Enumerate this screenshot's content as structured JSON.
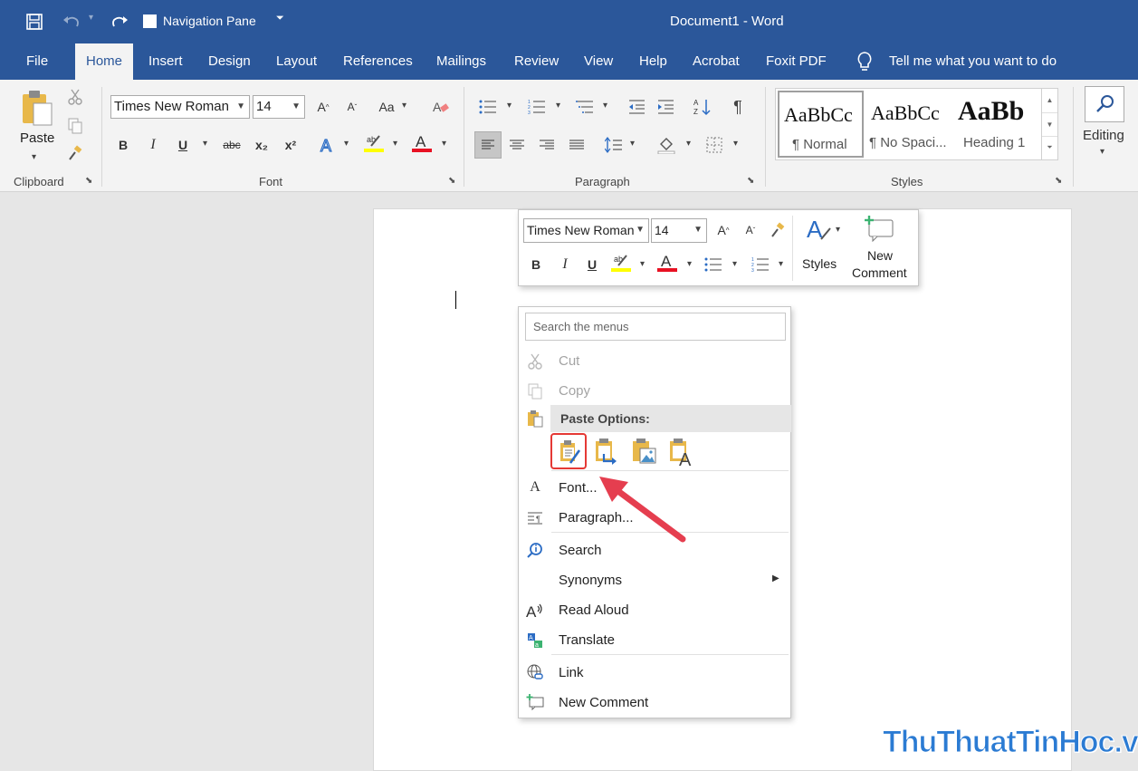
{
  "titlebar": {
    "qat_checkbox_label": "Navigation Pane",
    "doc_title": "Document1 - Word"
  },
  "tabs": [
    "File",
    "Home",
    "Insert",
    "Design",
    "Layout",
    "References",
    "Mailings",
    "Review",
    "View",
    "Help",
    "Acrobat",
    "Foxit PDF"
  ],
  "tell_me": "Tell me what you want to do",
  "ribbon": {
    "clipboard": {
      "paste_label": "Paste",
      "group_label": "Clipboard"
    },
    "font": {
      "font_name": "Times New Roman",
      "font_size": "14",
      "group_label": "Font",
      "change_case": "Aa",
      "bold": "B",
      "italic": "I",
      "underline": "U",
      "strikethrough": "abc",
      "subscript": "x₂",
      "superscript": "x²",
      "highlight_color": "#ffff00",
      "font_color": "#e81123"
    },
    "paragraph": {
      "group_label": "Paragraph",
      "pilcrow": "¶"
    },
    "styles": {
      "group_label": "Styles",
      "items": [
        {
          "preview": "AaBbCc",
          "name": "¶ Normal"
        },
        {
          "preview": "AaBbCc",
          "name": "¶ No Spaci..."
        },
        {
          "preview": "AaBb",
          "name": "Heading 1"
        }
      ]
    },
    "editing": {
      "label": "Editing"
    }
  },
  "mini_toolbar": {
    "font_name": "Times New Roman",
    "font_size": "14",
    "bold": "B",
    "italic": "I",
    "underline": "U",
    "styles_label": "Styles",
    "new_comment_line1": "New",
    "new_comment_line2": "Comment"
  },
  "context_menu": {
    "search_placeholder": "Search the menus",
    "cut": "Cut",
    "copy": "Copy",
    "paste_options_header": "Paste Options:",
    "font": "Font...",
    "paragraph": "Paragraph...",
    "search": "Search",
    "synonyms": "Synonyms",
    "read_aloud": "Read Aloud",
    "translate": "Translate",
    "link": "Link",
    "new_comment": "New Comment"
  },
  "watermark": "ThuThuatTinHoc.vn",
  "colors": {
    "accent": "#2b579a",
    "highlight_box": "#e53935",
    "arrow": "#e53e4f"
  }
}
